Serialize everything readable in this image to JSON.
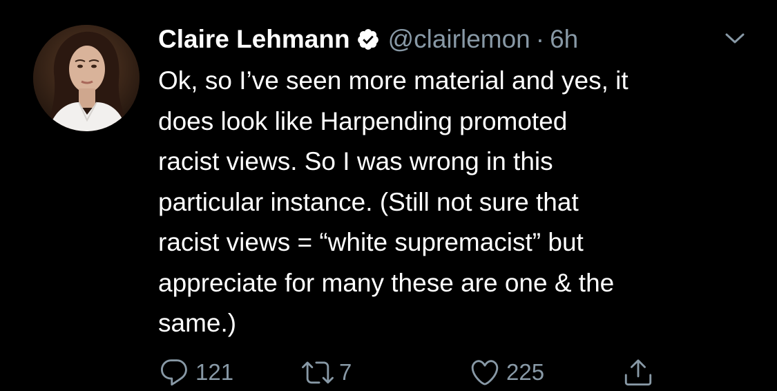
{
  "colors": {
    "background": "#000000",
    "text": "#ffffff",
    "muted": "#8899a6"
  },
  "tweet": {
    "author": {
      "display_name": "Claire Lehmann",
      "handle": "@clairlemon",
      "verified": true
    },
    "separator": "·",
    "time": "6h",
    "text": "Ok, so I’ve seen more material and yes, it\ndoes look like Harpending promoted\nracist views. So I was wrong in this\nparticular instance. (Still not sure that\nracist views = “white supremacist” but\nappreciate for many these are one & the\nsame.)",
    "actions": {
      "replies": "121",
      "retweets": "7",
      "likes": "225"
    },
    "icons": [
      "verified-badge-icon",
      "chevron-down-icon",
      "reply-icon",
      "retweet-icon",
      "like-icon",
      "share-icon"
    ]
  }
}
